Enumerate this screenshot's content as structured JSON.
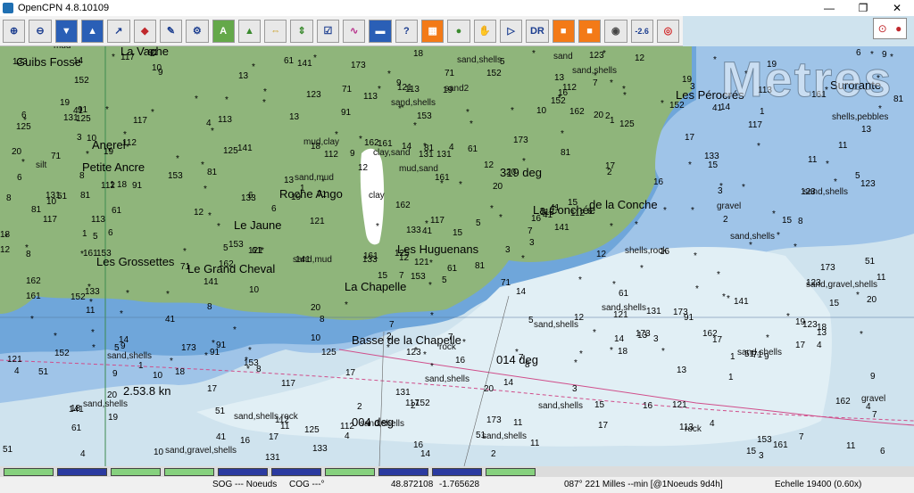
{
  "window": {
    "title": "OpenCPN 4.8.10109",
    "minimize": "—",
    "restore": "❐",
    "close": "✕"
  },
  "toolbar": {
    "tools": [
      "zoom-in",
      "zoom-out",
      "scale-in",
      "scale-out",
      "route",
      "waypoint",
      "tracking",
      "settings",
      "text",
      "ais",
      "follow",
      "settings2",
      "tides",
      "currents",
      "help",
      "chart-info",
      "route-manager",
      "track",
      "drop-mark",
      "mob",
      "dr",
      "orange-a",
      "orange-b",
      "globe",
      "counter",
      "lifebuoy"
    ],
    "dr_label": "DR",
    "counter_label": "-2.6"
  },
  "chart": {
    "watermark": "Metres",
    "places": [
      {
        "label": "Guibs Fosse"
      },
      {
        "label": "La Vache"
      },
      {
        "label": "Anerel"
      },
      {
        "label": "Petite Ancre"
      },
      {
        "label": "Roche Ango"
      },
      {
        "label": "Le Jaune"
      },
      {
        "label": "Les Grossettes"
      },
      {
        "label": "Le Grand Cheval"
      },
      {
        "label": "La Chapelle"
      },
      {
        "label": "Les Huguenans"
      },
      {
        "label": "La Conchée"
      },
      {
        "label": "Basse de la Chapelle"
      },
      {
        "label": "Les Pérocrés"
      },
      {
        "label": "Surorante"
      },
      {
        "label": "de la Conche"
      }
    ],
    "seabed": [
      "sand",
      "mud",
      "sand,mud",
      "sand,shells",
      "shells,rock",
      "gravel",
      "rock",
      "clay",
      "sand,gravel,shells",
      "sand,shells,rock",
      "shells,pebbles",
      "silt",
      "mud,clay",
      "sand2",
      "mud,sand",
      "sand,mud",
      "clay,sand",
      "sand,shells",
      "sand,shells",
      "sand,shells",
      "sand,shells",
      "rock",
      "sand,gravel,shells",
      "sand,shells",
      "sand,shells",
      "sand,shells",
      "sand,shells",
      "gravel",
      "sand,shells",
      "sand,shells",
      "sand,shells",
      "sand,shells",
      "sand,shells"
    ],
    "bearings": [
      "319 deg",
      "014 deg",
      "004 deg",
      "2.53.8 kn"
    ],
    "depths": [
      "5",
      "19",
      "12",
      "18",
      "16",
      "8",
      "7",
      "4",
      "2",
      "3",
      "9",
      "11",
      "6",
      "13",
      "15",
      "17",
      "10",
      "14",
      "20",
      "1",
      "71",
      "61",
      "51",
      "81",
      "41",
      "91",
      "112",
      "113",
      "117",
      "121",
      "123",
      "125",
      "131",
      "133",
      "141",
      "152",
      "153",
      "161",
      "162",
      "173"
    ]
  },
  "status": {
    "sog": "SOG --- Noeuds",
    "cog": "COG ---°",
    "lat": "48.872108",
    "lon": "-1.765628",
    "route": "087°  221 Milles --min [@1Noeuds 9d4h]",
    "scale": "Echelle 19400 (0.60x)"
  },
  "quilt": [
    "green",
    "blue",
    "green",
    "green",
    "blue",
    "blue",
    "green",
    "blue",
    "blue",
    "green"
  ],
  "colors": {
    "land": "#8fb57b",
    "shallow": "#9fc4e8",
    "deep": "#cfe3ee",
    "vshallow": "#6fa6da",
    "route": "#d04d8a",
    "quilt_green": "#86d17e",
    "quilt_blue": "#2b3aa0"
  }
}
